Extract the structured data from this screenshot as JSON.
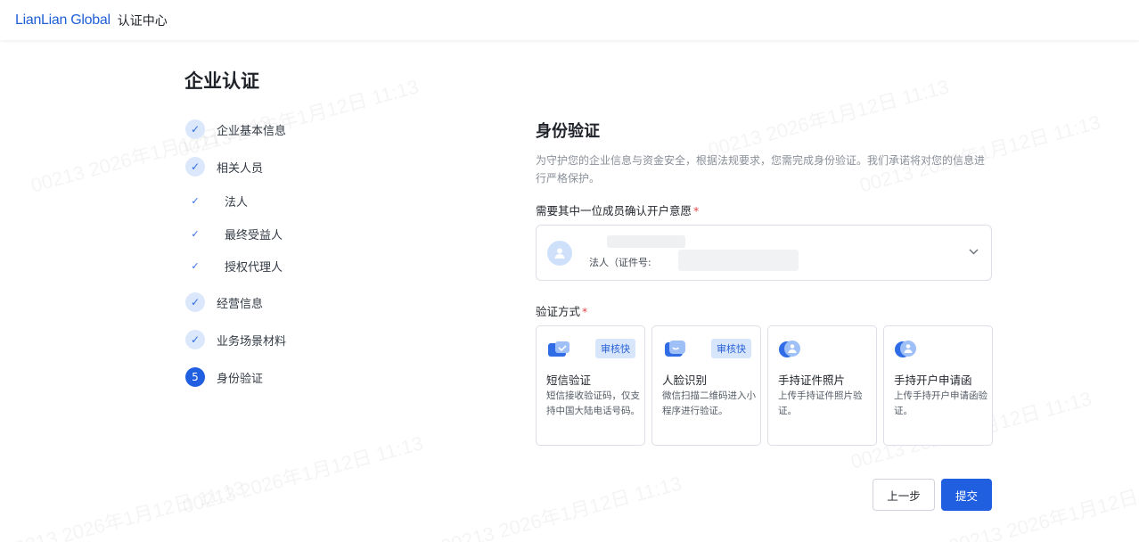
{
  "header": {
    "logo": "LianLian Global",
    "subtitle": "认证中心"
  },
  "page_title": "企业认证",
  "steps": [
    {
      "label": "企业基本信息",
      "status": "done"
    },
    {
      "label": "相关人员",
      "status": "done"
    },
    {
      "label": "法人",
      "status": "done",
      "sub": true
    },
    {
      "label": "最终受益人",
      "status": "done",
      "sub": true
    },
    {
      "label": "授权代理人",
      "status": "done",
      "sub": true
    },
    {
      "label": "经营信息",
      "status": "done"
    },
    {
      "label": "业务场景材料",
      "status": "done"
    },
    {
      "label": "身份验证",
      "status": "active",
      "number": "5"
    }
  ],
  "section": {
    "title": "身份验证",
    "description": "为守护您的企业信息与资金安全，根据法规要求，您需完成身份验证。我们承诺将对您的信息进行严格保护。",
    "member_label": "需要其中一位成员确认开户意愿",
    "member_role": "法人（证件号:",
    "method_label": "验证方式"
  },
  "methods": [
    {
      "title": "短信验证",
      "desc": "短信接收验证码，仅支持中国大陆电话号码。",
      "badge": "审核快",
      "icon": "sms-icon"
    },
    {
      "title": "人脸识别",
      "desc": "微信扫描二维码进入小程序进行验证。",
      "badge": "审核快",
      "icon": "face-icon"
    },
    {
      "title": "手持证件照片",
      "desc": "上传手持证件照片验证。",
      "badge": "",
      "icon": "id-photo-icon"
    },
    {
      "title": "手持开户申请函",
      "desc": "上传手持开户申请函验证。",
      "badge": "",
      "icon": "letter-photo-icon"
    }
  ],
  "buttons": {
    "prev": "上一步",
    "submit": "提交"
  },
  "watermark": "00213 2026年1月12日 11:13",
  "colors": {
    "primary": "#1f5fe0",
    "required": "#e5484d"
  }
}
